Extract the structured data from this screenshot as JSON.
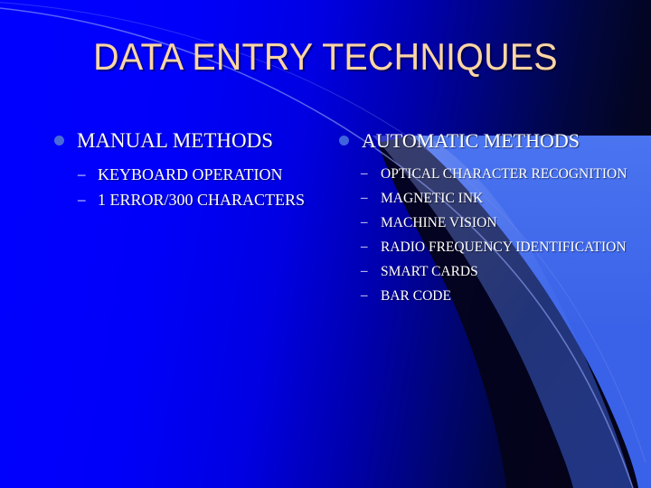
{
  "slide": {
    "title": "DATA ENTRY TECHNIQUES",
    "title_color": "#fbd5a4",
    "body_text_color": "#ffffff",
    "background": {
      "left_color": "#0000ff",
      "right_color": "#05041a",
      "accent_wedge_color": "#3a62e8",
      "accent_curve_color": "#7f93f0"
    },
    "columns": [
      {
        "bullet_color": "#4a6ad8",
        "heading": "MANUAL METHODS",
        "items": [
          "KEYBOARD OPERATION",
          "1 ERROR/300 CHARACTERS"
        ]
      },
      {
        "bullet_color": "#3f63dd",
        "heading": "AUTOMATIC METHODS",
        "items": [
          "OPTICAL CHARACTER RECOGNITION",
          "MAGNETIC INK",
          "MACHINE VISION",
          "RADIO FREQUENCY IDENTIFICATION",
          "SMART CARDS",
          "BAR CODE"
        ]
      }
    ]
  }
}
